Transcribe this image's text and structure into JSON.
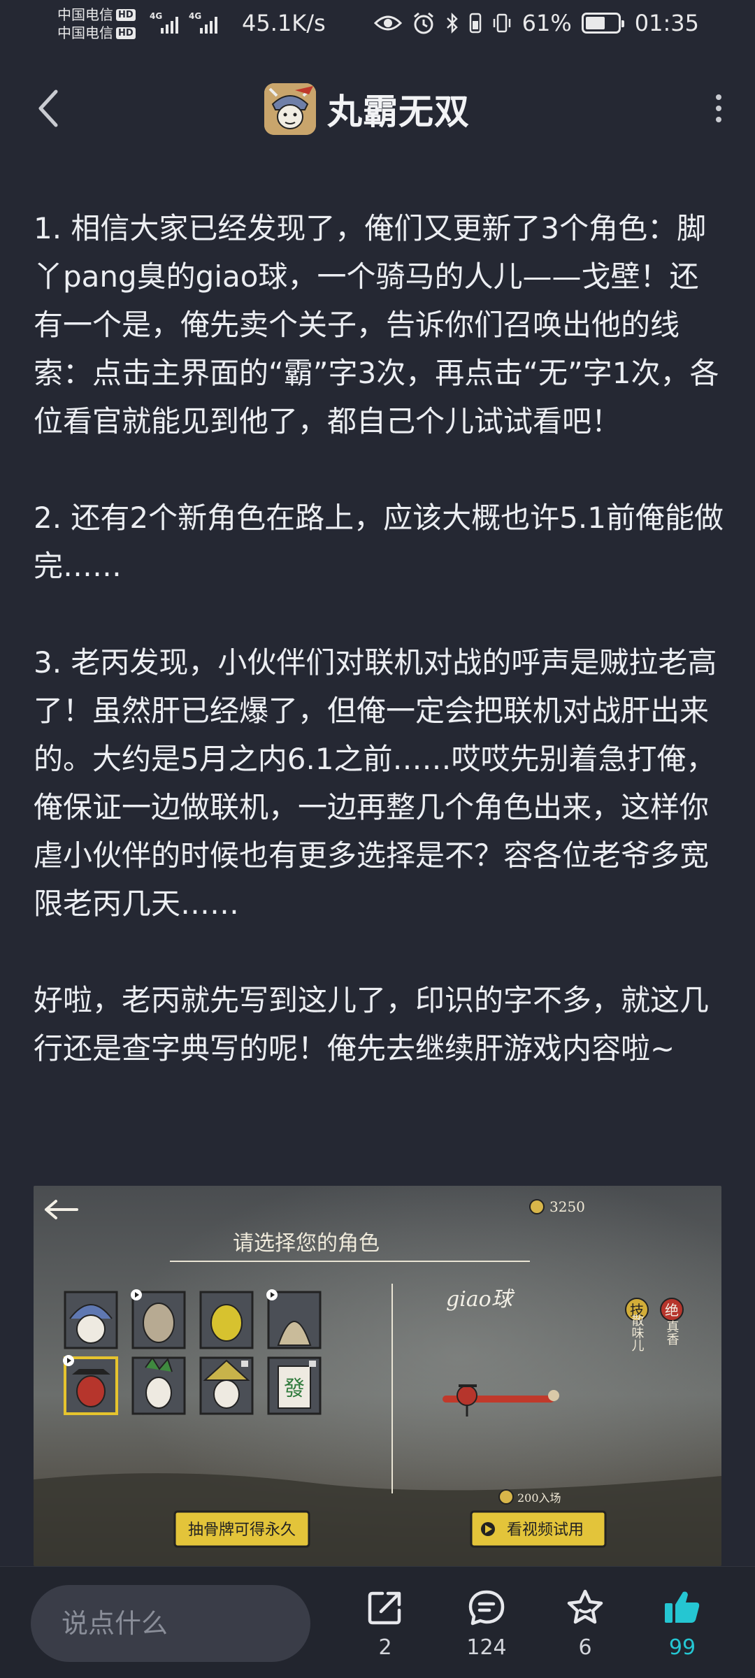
{
  "status_bar": {
    "carrier_1": "中国电信",
    "carrier_2": "中国电信",
    "hd": "HD",
    "network_1": "4G",
    "network_2": "4G",
    "net_speed": "45.1K/s",
    "battery_percent": "61%",
    "battery_level": 0.61,
    "time": "01:35"
  },
  "header": {
    "title": "丸霸无双",
    "back_icon": "chevron-left-icon",
    "more_icon": "more-vertical-icon"
  },
  "article": {
    "p1": "1. 相信大家已经发现了，俺们又更新了3个角色：脚丫pang臭的giao球，一个骑马的人儿——戈壁！还有一个是，俺先卖个关子，告诉你们召唤出他的线索：点击主界面的“霸”字3次，再点击“无”字1次，各位看官就能见到他了，都自己个儿试试看吧！",
    "p2": "2. 还有2个新角色在路上，应该大概也许5.1前俺能做完……",
    "p3": "3. 老丙发现，小伙伴们对联机对战的呼声是贼拉老高了！虽然肝已经爆了，但俺一定会把联机对战肝出来的。大约是5月之内6.1之前……哎哎先别着急打俺，俺保证一边做联机，一边再整几个角色出来，这样你虐小伙伴的时候也有更多选择是不？容各位老爷多宽限老丙几天……",
    "p4": "好啦，老丙就先写到这儿了，印识的字不多，就这几行还是查字典写的呢！俺先去继续肝游戏内容啦~"
  },
  "game_screenshot": {
    "coins": "3250",
    "prompt": "请选择您的角色",
    "selected_character": "giao球",
    "skill_1": "技",
    "skill_2": "绝",
    "skill_1_desc": "散味儿",
    "skill_2_desc": "真香",
    "tile_char": "發",
    "unlock_price": "200入场",
    "button_left": "抽骨牌可得永久",
    "button_right": "看视频试用"
  },
  "bottom_bar": {
    "comment_placeholder": "说点什么",
    "share_count": "2",
    "comment_count": "124",
    "favorite_count": "6",
    "like_count": "99",
    "like_color": "#25c6d2"
  }
}
